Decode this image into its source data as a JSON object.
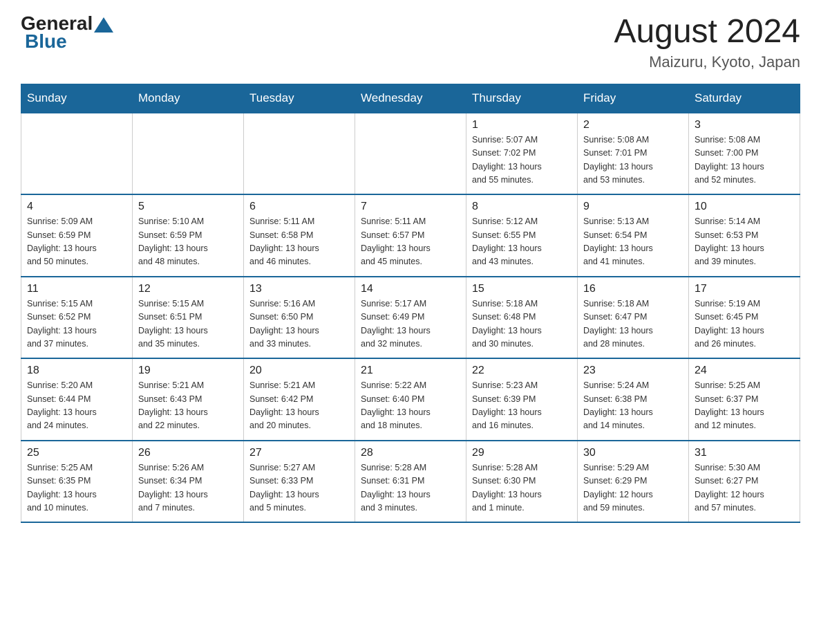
{
  "header": {
    "logo_general": "General",
    "logo_blue": "Blue",
    "month_year": "August 2024",
    "location": "Maizuru, Kyoto, Japan"
  },
  "days_of_week": [
    "Sunday",
    "Monday",
    "Tuesday",
    "Wednesday",
    "Thursday",
    "Friday",
    "Saturday"
  ],
  "weeks": [
    [
      {
        "day": "",
        "info": ""
      },
      {
        "day": "",
        "info": ""
      },
      {
        "day": "",
        "info": ""
      },
      {
        "day": "",
        "info": ""
      },
      {
        "day": "1",
        "info": "Sunrise: 5:07 AM\nSunset: 7:02 PM\nDaylight: 13 hours\nand 55 minutes."
      },
      {
        "day": "2",
        "info": "Sunrise: 5:08 AM\nSunset: 7:01 PM\nDaylight: 13 hours\nand 53 minutes."
      },
      {
        "day": "3",
        "info": "Sunrise: 5:08 AM\nSunset: 7:00 PM\nDaylight: 13 hours\nand 52 minutes."
      }
    ],
    [
      {
        "day": "4",
        "info": "Sunrise: 5:09 AM\nSunset: 6:59 PM\nDaylight: 13 hours\nand 50 minutes."
      },
      {
        "day": "5",
        "info": "Sunrise: 5:10 AM\nSunset: 6:59 PM\nDaylight: 13 hours\nand 48 minutes."
      },
      {
        "day": "6",
        "info": "Sunrise: 5:11 AM\nSunset: 6:58 PM\nDaylight: 13 hours\nand 46 minutes."
      },
      {
        "day": "7",
        "info": "Sunrise: 5:11 AM\nSunset: 6:57 PM\nDaylight: 13 hours\nand 45 minutes."
      },
      {
        "day": "8",
        "info": "Sunrise: 5:12 AM\nSunset: 6:55 PM\nDaylight: 13 hours\nand 43 minutes."
      },
      {
        "day": "9",
        "info": "Sunrise: 5:13 AM\nSunset: 6:54 PM\nDaylight: 13 hours\nand 41 minutes."
      },
      {
        "day": "10",
        "info": "Sunrise: 5:14 AM\nSunset: 6:53 PM\nDaylight: 13 hours\nand 39 minutes."
      }
    ],
    [
      {
        "day": "11",
        "info": "Sunrise: 5:15 AM\nSunset: 6:52 PM\nDaylight: 13 hours\nand 37 minutes."
      },
      {
        "day": "12",
        "info": "Sunrise: 5:15 AM\nSunset: 6:51 PM\nDaylight: 13 hours\nand 35 minutes."
      },
      {
        "day": "13",
        "info": "Sunrise: 5:16 AM\nSunset: 6:50 PM\nDaylight: 13 hours\nand 33 minutes."
      },
      {
        "day": "14",
        "info": "Sunrise: 5:17 AM\nSunset: 6:49 PM\nDaylight: 13 hours\nand 32 minutes."
      },
      {
        "day": "15",
        "info": "Sunrise: 5:18 AM\nSunset: 6:48 PM\nDaylight: 13 hours\nand 30 minutes."
      },
      {
        "day": "16",
        "info": "Sunrise: 5:18 AM\nSunset: 6:47 PM\nDaylight: 13 hours\nand 28 minutes."
      },
      {
        "day": "17",
        "info": "Sunrise: 5:19 AM\nSunset: 6:45 PM\nDaylight: 13 hours\nand 26 minutes."
      }
    ],
    [
      {
        "day": "18",
        "info": "Sunrise: 5:20 AM\nSunset: 6:44 PM\nDaylight: 13 hours\nand 24 minutes."
      },
      {
        "day": "19",
        "info": "Sunrise: 5:21 AM\nSunset: 6:43 PM\nDaylight: 13 hours\nand 22 minutes."
      },
      {
        "day": "20",
        "info": "Sunrise: 5:21 AM\nSunset: 6:42 PM\nDaylight: 13 hours\nand 20 minutes."
      },
      {
        "day": "21",
        "info": "Sunrise: 5:22 AM\nSunset: 6:40 PM\nDaylight: 13 hours\nand 18 minutes."
      },
      {
        "day": "22",
        "info": "Sunrise: 5:23 AM\nSunset: 6:39 PM\nDaylight: 13 hours\nand 16 minutes."
      },
      {
        "day": "23",
        "info": "Sunrise: 5:24 AM\nSunset: 6:38 PM\nDaylight: 13 hours\nand 14 minutes."
      },
      {
        "day": "24",
        "info": "Sunrise: 5:25 AM\nSunset: 6:37 PM\nDaylight: 13 hours\nand 12 minutes."
      }
    ],
    [
      {
        "day": "25",
        "info": "Sunrise: 5:25 AM\nSunset: 6:35 PM\nDaylight: 13 hours\nand 10 minutes."
      },
      {
        "day": "26",
        "info": "Sunrise: 5:26 AM\nSunset: 6:34 PM\nDaylight: 13 hours\nand 7 minutes."
      },
      {
        "day": "27",
        "info": "Sunrise: 5:27 AM\nSunset: 6:33 PM\nDaylight: 13 hours\nand 5 minutes."
      },
      {
        "day": "28",
        "info": "Sunrise: 5:28 AM\nSunset: 6:31 PM\nDaylight: 13 hours\nand 3 minutes."
      },
      {
        "day": "29",
        "info": "Sunrise: 5:28 AM\nSunset: 6:30 PM\nDaylight: 13 hours\nand 1 minute."
      },
      {
        "day": "30",
        "info": "Sunrise: 5:29 AM\nSunset: 6:29 PM\nDaylight: 12 hours\nand 59 minutes."
      },
      {
        "day": "31",
        "info": "Sunrise: 5:30 AM\nSunset: 6:27 PM\nDaylight: 12 hours\nand 57 minutes."
      }
    ]
  ]
}
